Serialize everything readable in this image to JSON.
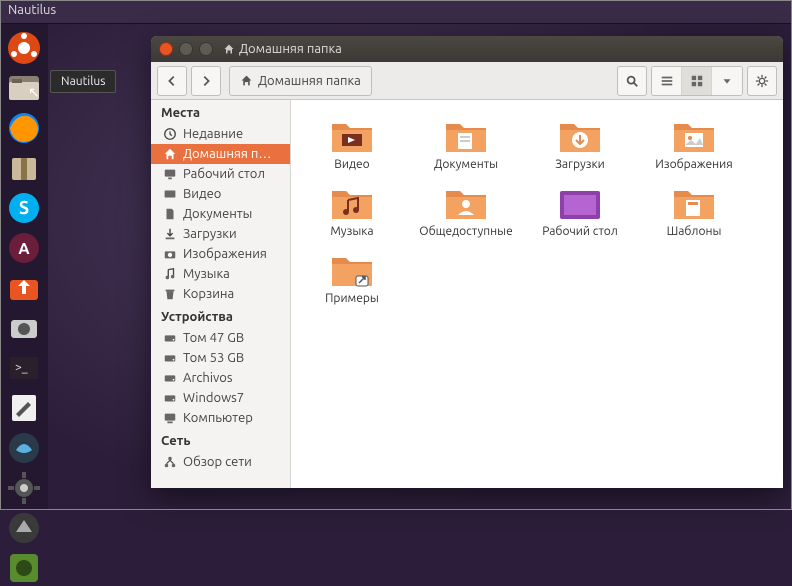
{
  "menubar": {
    "app_name": "Nautilus"
  },
  "tooltip": "Nautilus",
  "window": {
    "title": "Домашняя папка",
    "breadcrumb": "Домашняя папка"
  },
  "sidebar": {
    "places_header": "Места",
    "places": [
      {
        "label": "Недавние",
        "icon": "clock"
      },
      {
        "label": "Домашняя п…",
        "icon": "home",
        "active": true
      },
      {
        "label": "Рабочий стол",
        "icon": "desktop"
      },
      {
        "label": "Видео",
        "icon": "video"
      },
      {
        "label": "Документы",
        "icon": "doc"
      },
      {
        "label": "Загрузки",
        "icon": "download"
      },
      {
        "label": "Изображения",
        "icon": "camera"
      },
      {
        "label": "Музыка",
        "icon": "music"
      },
      {
        "label": "Корзина",
        "icon": "trash"
      }
    ],
    "devices_header": "Устройства",
    "devices": [
      {
        "label": "Том 47 GB",
        "icon": "drive"
      },
      {
        "label": "Том 53 GB",
        "icon": "drive"
      },
      {
        "label": "Archivos",
        "icon": "drive"
      },
      {
        "label": "Windows7",
        "icon": "drive"
      },
      {
        "label": "Компьютер",
        "icon": "computer"
      }
    ],
    "network_header": "Сеть",
    "network": [
      {
        "label": "Обзор сети",
        "icon": "network"
      }
    ]
  },
  "folders": [
    {
      "label": "Видео",
      "type": "video"
    },
    {
      "label": "Документы",
      "type": "doc"
    },
    {
      "label": "Загрузки",
      "type": "download"
    },
    {
      "label": "Изображения",
      "type": "image"
    },
    {
      "label": "Музыка",
      "type": "music"
    },
    {
      "label": "Общедоступные",
      "type": "public"
    },
    {
      "label": "Рабочий стол",
      "type": "desktop"
    },
    {
      "label": "Шаблоны",
      "type": "template"
    },
    {
      "label": "Примеры",
      "type": "link"
    }
  ]
}
